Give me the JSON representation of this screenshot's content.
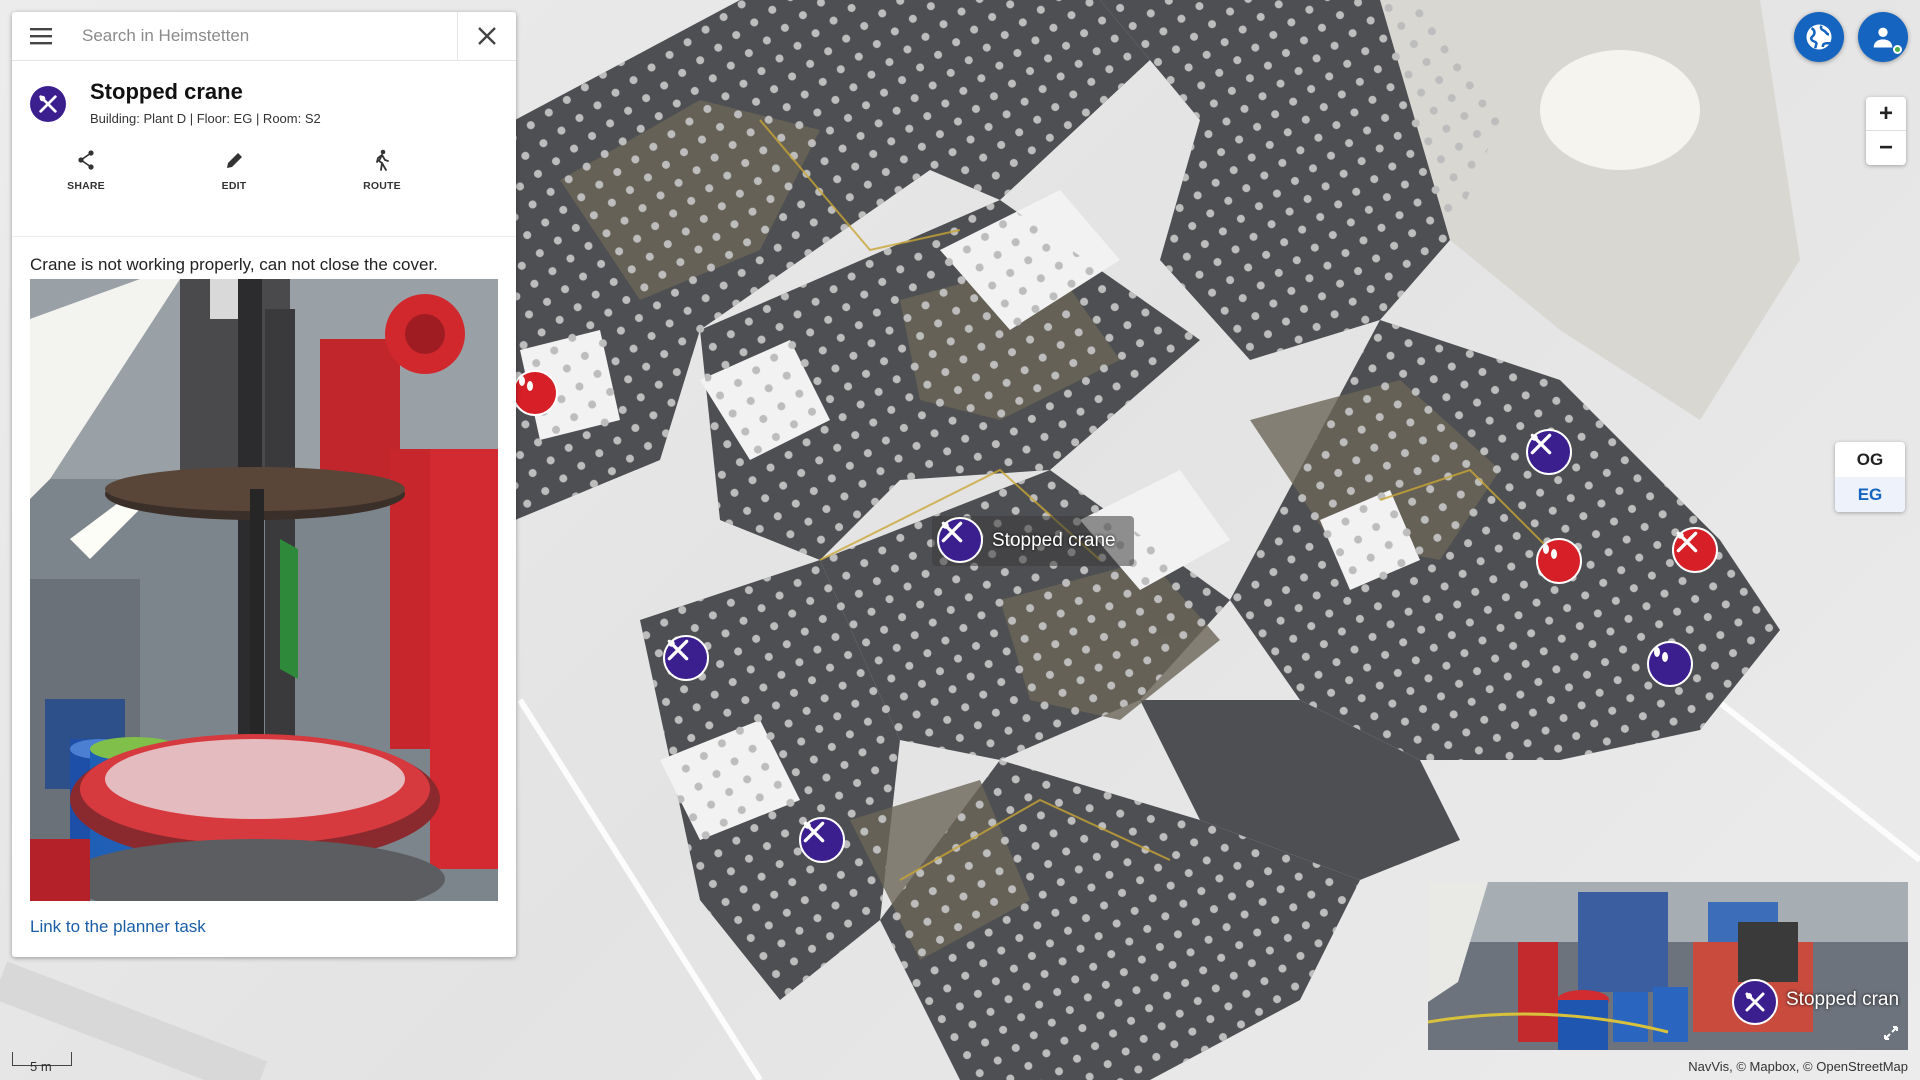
{
  "search": {
    "placeholder": "Search in Heimstetten"
  },
  "poi": {
    "title": "Stopped crane",
    "subtitle": "Building: Plant D | Floor: EG | Room: S2",
    "icon": "wrench-screwdriver-icon",
    "description": "Crane is not working properly, can not close the cover.",
    "link_text": "Link to the planner task"
  },
  "actions": [
    {
      "label": "SHARE",
      "icon": "share-icon"
    },
    {
      "label": "EDIT",
      "icon": "pencil-icon"
    },
    {
      "label": "ROUTE",
      "icon": "walking-person-icon"
    }
  ],
  "floors": {
    "upper": "OG",
    "current": "EG"
  },
  "zoom": {
    "in": "+",
    "out": "−"
  },
  "map": {
    "selected_label": "Stopped crane",
    "preview_label": "Stopped cran",
    "scale": "5 m",
    "attribution": "NavVis, © Mapbox, © OpenStreetMap"
  },
  "colors": {
    "accent": "#1565c0",
    "poi_purple": "#3b1f8f",
    "poi_red": "#d61f26"
  }
}
